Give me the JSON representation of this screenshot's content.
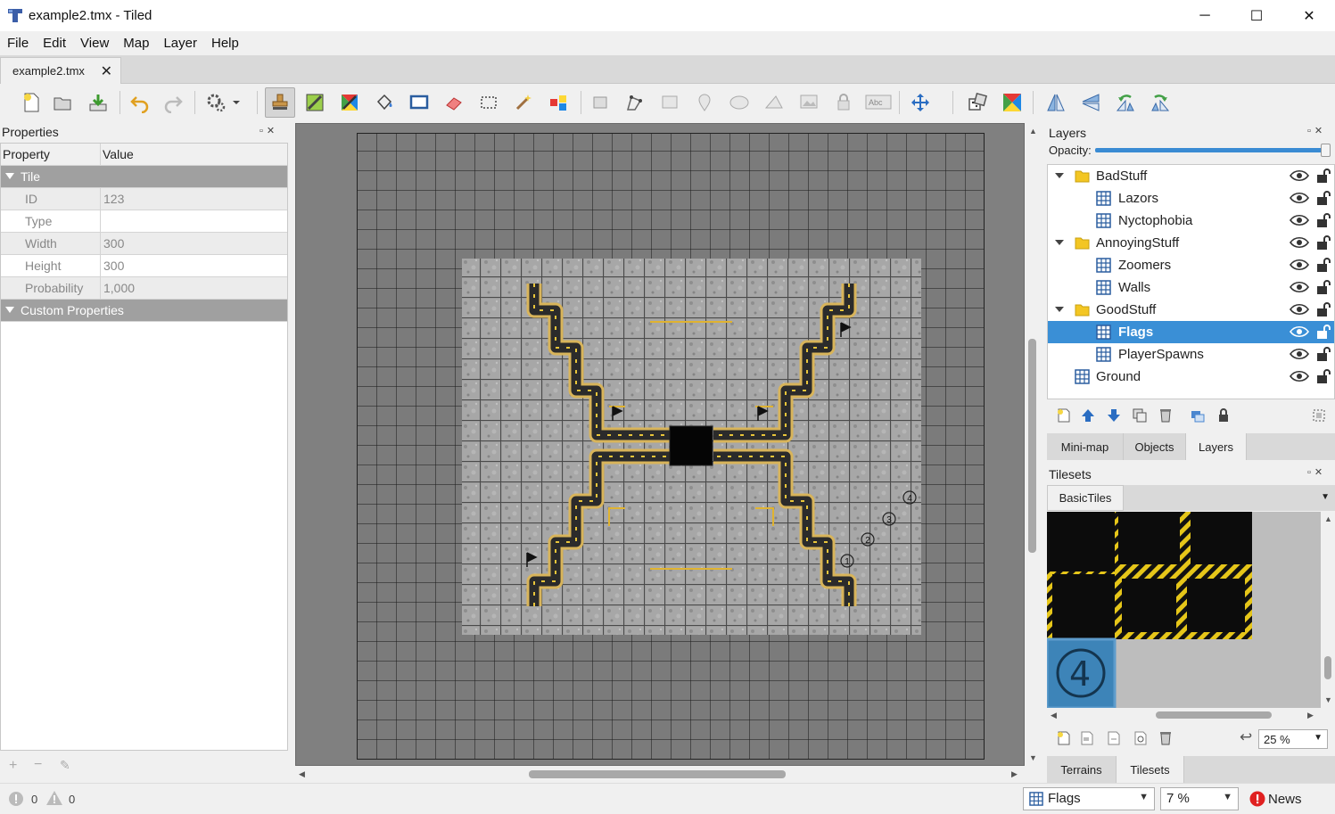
{
  "window": {
    "title": "example2.tmx - Tiled",
    "minimize": "─",
    "maximize": "☐",
    "close": "✕"
  },
  "menu": [
    "File",
    "Edit",
    "View",
    "Map",
    "Layer",
    "Help"
  ],
  "document_tab": {
    "label": "example2.tmx",
    "close": "✕"
  },
  "properties": {
    "title": "Properties",
    "dock_buttons": "▫✕",
    "header": {
      "property": "Property",
      "value": "Value"
    },
    "group_tile": "Tile",
    "rows": [
      {
        "name": "ID",
        "value": "123"
      },
      {
        "name": "Type",
        "value": ""
      },
      {
        "name": "Width",
        "value": "300"
      },
      {
        "name": "Height",
        "value": "300"
      },
      {
        "name": "Probability",
        "value": "1,000"
      }
    ],
    "group_custom": "Custom Properties",
    "bottom_buttons": {
      "add": "+",
      "remove": "−",
      "edit": "✎"
    }
  },
  "layers": {
    "title": "Layers",
    "opacity_label": "Opacity:",
    "opacity": 1.0,
    "items": [
      {
        "name": "BadStuff",
        "type": "group"
      },
      {
        "name": "Lazors",
        "type": "tile"
      },
      {
        "name": "Nyctophobia",
        "type": "tile"
      },
      {
        "name": "AnnoyingStuff",
        "type": "group"
      },
      {
        "name": "Zoomers",
        "type": "tile"
      },
      {
        "name": "Walls",
        "type": "tile"
      },
      {
        "name": "GoodStuff",
        "type": "group"
      },
      {
        "name": "Flags",
        "type": "tile",
        "selected": true
      },
      {
        "name": "PlayerSpawns",
        "type": "tile"
      },
      {
        "name": "Ground",
        "type": "tile"
      }
    ],
    "tabs": [
      "Mini-map",
      "Objects",
      "Layers"
    ],
    "active_tab": "Layers"
  },
  "tilesets": {
    "title": "Tilesets",
    "tab": "BasicTiles",
    "zoom": "25 %",
    "tile_number": "4",
    "bottom_tabs": [
      "Terrains",
      "Tilesets"
    ],
    "active_bottom_tab": "Tilesets"
  },
  "map": {
    "spawn_numbers": [
      "1",
      "2",
      "3",
      "4"
    ]
  },
  "status": {
    "errors": "0",
    "warnings": "0",
    "layer_combo": "Flags",
    "zoom_combo": "7 %",
    "news": "News"
  },
  "colors": {
    "selection": "#3a8fd6",
    "road": "#2b2b2b",
    "road_border": "#d8b45a",
    "arrow": "#e8c53a"
  }
}
